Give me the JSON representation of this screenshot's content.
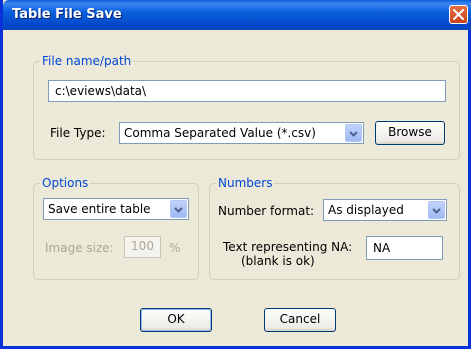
{
  "window": {
    "title": "Table File Save"
  },
  "file_group": {
    "legend": "File name/path",
    "path_value": "c:\\eviews\\data\\",
    "file_type_label": "File Type:",
    "file_type_value": "Comma Separated Value (*.csv)",
    "browse_label": "Browse"
  },
  "options_group": {
    "legend": "Options",
    "save_mode_value": "Save entire table",
    "image_size_label": "Image size:",
    "image_size_value": "100",
    "image_size_unit": "%"
  },
  "numbers_group": {
    "legend": "Numbers",
    "number_format_label": "Number format:",
    "number_format_value": "As displayed",
    "na_label_line1": "Text representing NA:",
    "na_label_line2": "(blank is ok)",
    "na_value": "NA"
  },
  "buttons": {
    "ok_label": "OK",
    "cancel_label": "Cancel"
  }
}
